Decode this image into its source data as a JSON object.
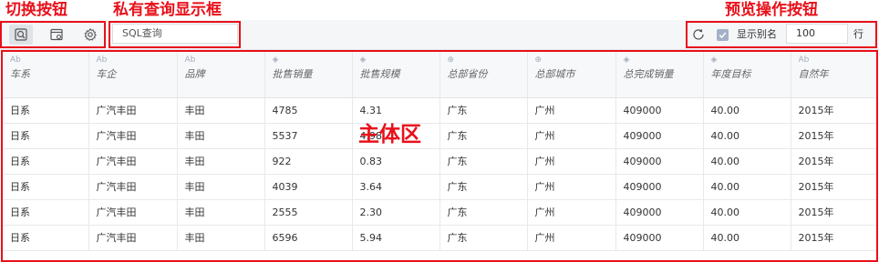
{
  "annotations": {
    "switch_buttons": "切换按钮",
    "private_query_box": "私有查询显示框",
    "preview_buttons": "预览操作按钮",
    "main_area": "主体区"
  },
  "toolbar": {
    "icons": [
      "query-preview-icon",
      "data-preview-icon",
      "settings-gear-icon",
      "refresh-icon"
    ],
    "sql_box_text": "SQL查询",
    "show_alias_label": "显示别名",
    "show_alias_checked": true,
    "row_count_value": "100",
    "row_unit_label": "行"
  },
  "table": {
    "columns": [
      {
        "name": "车系",
        "type_icon": "text-type-icon",
        "glyph": "Ab"
      },
      {
        "name": "车企",
        "type_icon": "text-type-icon",
        "glyph": "Ab"
      },
      {
        "name": "品牌",
        "type_icon": "text-type-icon",
        "glyph": "Ab"
      },
      {
        "name": "批售销量",
        "type_icon": "measure-type-icon",
        "glyph": "◈"
      },
      {
        "name": "批售规模",
        "type_icon": "measure-type-icon",
        "glyph": "◈"
      },
      {
        "name": "总部省份",
        "type_icon": "geo-type-icon",
        "glyph": "⊕"
      },
      {
        "name": "总部城市",
        "type_icon": "geo-type-icon",
        "glyph": "⊕"
      },
      {
        "name": "总完成销量",
        "type_icon": "measure-type-icon",
        "glyph": "◈"
      },
      {
        "name": "年度目标",
        "type_icon": "measure-type-icon",
        "glyph": "◈"
      },
      {
        "name": "自然年",
        "type_icon": "text-type-icon",
        "glyph": "Ab"
      }
    ],
    "rows": [
      [
        "日系",
        "广汽丰田",
        "丰田",
        "4785",
        "4.31",
        "广东",
        "广州",
        "409000",
        "40.00",
        "2015年"
      ],
      [
        "日系",
        "广汽丰田",
        "丰田",
        "5537",
        "4.98",
        "广东",
        "广州",
        "409000",
        "40.00",
        "2015年"
      ],
      [
        "日系",
        "广汽丰田",
        "丰田",
        "922",
        "0.83",
        "广东",
        "广州",
        "409000",
        "40.00",
        "2015年"
      ],
      [
        "日系",
        "广汽丰田",
        "丰田",
        "4039",
        "3.64",
        "广东",
        "广州",
        "409000",
        "40.00",
        "2015年"
      ],
      [
        "日系",
        "广汽丰田",
        "丰田",
        "2555",
        "2.30",
        "广东",
        "广州",
        "409000",
        "40.00",
        "2015年"
      ],
      [
        "日系",
        "广汽丰田",
        "丰田",
        "6596",
        "5.94",
        "广东",
        "广州",
        "409000",
        "40.00",
        "2015年"
      ]
    ]
  },
  "colors": {
    "annotation": "#e8101a",
    "header_bg": "#f7f8fa",
    "toolbar_bg": "#f5f6f8",
    "checkbox": "#a3b1c6"
  }
}
